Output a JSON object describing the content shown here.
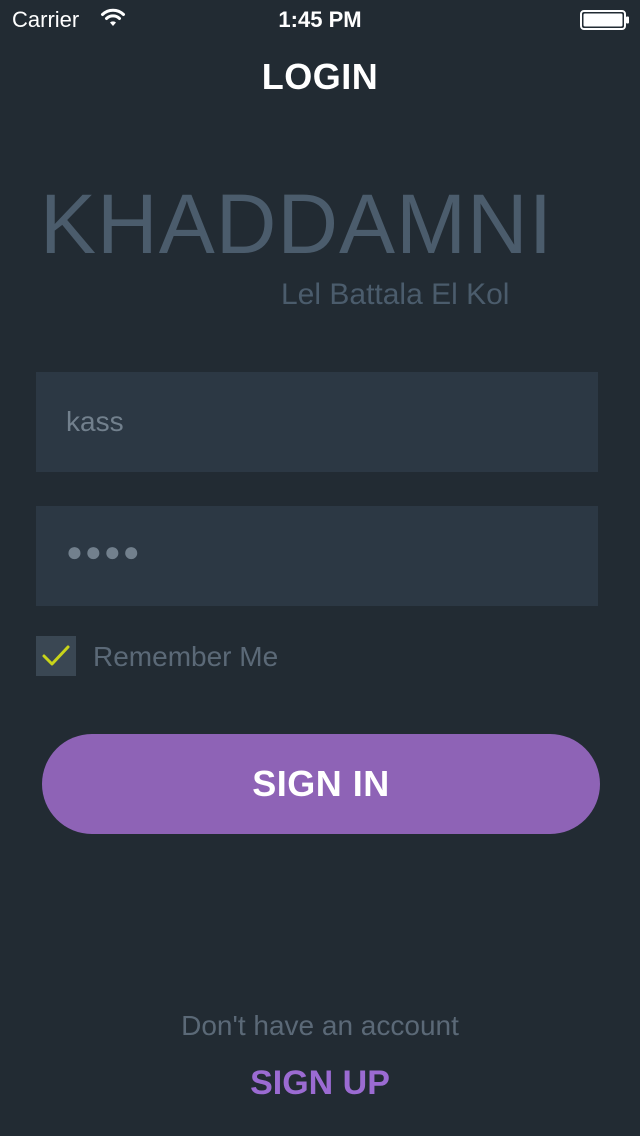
{
  "status_bar": {
    "carrier": "Carrier",
    "time": "1:45 PM",
    "wifi_icon": "wifi-icon",
    "battery_icon": "battery-icon"
  },
  "nav": {
    "title": "LOGIN"
  },
  "logo": {
    "title": "KHADDAMNI",
    "subtitle": "Lel Battala El Kol"
  },
  "form": {
    "username_value": "kass",
    "password_masked": "●●●●",
    "remember_label": "Remember Me",
    "remember_checked": true,
    "check_icon": "checkmark-icon",
    "signin_label": "SIGN IN"
  },
  "footer": {
    "prompt": "Don't have an account",
    "signup_label": "SIGN UP"
  },
  "colors": {
    "background": "#222b33",
    "field_background": "#2c3844",
    "accent": "#8e63b6",
    "signup": "#9b6bd2",
    "check": "#c8d41a",
    "logo_text": "#4b5c6c"
  }
}
